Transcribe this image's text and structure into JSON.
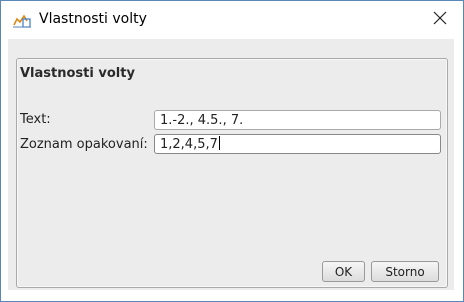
{
  "window": {
    "title": "Vlastnosti volty",
    "app_icon": "chart-line-icon",
    "close_icon": "close-icon"
  },
  "panel": {
    "title": "Vlastnosti volty"
  },
  "form": {
    "text_label": "Text:",
    "text_value": "1.-2., 4.5., 7.",
    "repeats_label": "Zoznam opakovaní:",
    "repeats_value": "1,2,4,5,7"
  },
  "buttons": {
    "ok_label": "OK",
    "cancel_label": "Storno"
  }
}
